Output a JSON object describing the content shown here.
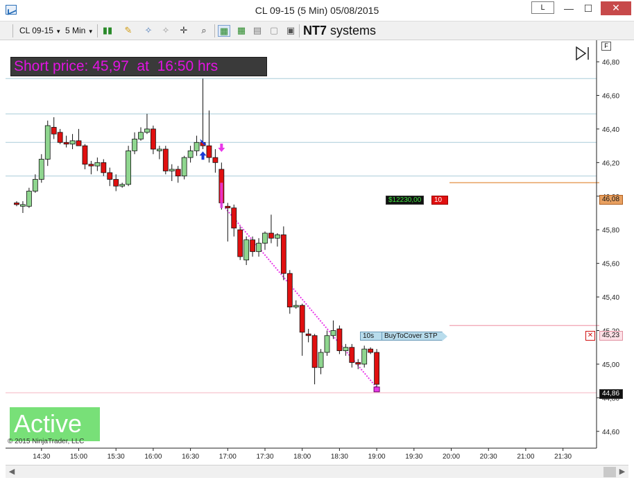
{
  "window": {
    "title": "CL 09-15 (5 Min)  05/08/2015",
    "layout_button": "L",
    "minimize": "—",
    "maximize": "☐",
    "close": "✕"
  },
  "toolbar": {
    "instrument": "CL 09-15",
    "interval": "5 Min",
    "brand_bold": "NT7",
    "brand_rest": " systems"
  },
  "chart": {
    "banner": "Short price: 45,97  at  16:50 hrs",
    "status": "Active",
    "copyright": "© 2015 NinjaTrader, LLC",
    "f_button": "F",
    "order_ticket": {
      "pnl": "$12230,00",
      "qty": "10",
      "price_tag": "46,08"
    },
    "stop_order": {
      "time_left": "10s",
      "label": "BuyToCover STP",
      "cancel": "✕",
      "price_tag": "45,23"
    },
    "last_price_tag": "44,86",
    "colors": {
      "up": "#8fd68f",
      "down": "#e01010",
      "signal": "#e838e8",
      "entry": "#1a3ad8",
      "grid": "#a8ccd8",
      "order_line": "#e8a060",
      "stop_line": "#f0a0b0",
      "last_line": "#f5b5c0"
    }
  },
  "chart_data": {
    "type": "candlestick",
    "title": "",
    "xlabel": "",
    "ylabel": "",
    "ylim": [
      44.5,
      46.92
    ],
    "y_ticks": [
      "46,80",
      "46,60",
      "46,40",
      "46,20",
      "46,00",
      "45,80",
      "45,60",
      "45,40",
      "45,20",
      "45,00",
      "44,80",
      "44,60"
    ],
    "y_tick_values": [
      46.8,
      46.6,
      46.4,
      46.2,
      46.0,
      45.8,
      45.6,
      45.4,
      45.2,
      45.0,
      44.8,
      44.6
    ],
    "x_ticks": [
      "14:30",
      "15:00",
      "15:30",
      "16:00",
      "16:30",
      "17:00",
      "17:30",
      "18:00",
      "18:30",
      "19:00",
      "19:30",
      "20:00",
      "20:30",
      "21:00",
      "21:30"
    ],
    "x_tick_minutes": [
      870,
      900,
      930,
      960,
      990,
      1020,
      1050,
      1080,
      1110,
      1140,
      1170,
      1200,
      1230,
      1260,
      1290
    ],
    "x_range_minutes": [
      840,
      1315
    ],
    "h_lines": [
      46.7,
      46.49,
      46.32,
      46.12,
      44.83
    ],
    "order_level": 46.08,
    "stop_level": 45.23,
    "last_price": 44.86,
    "bar_minutes": 5,
    "bars": [
      {
        "t": 850,
        "o": 45.96,
        "h": 45.97,
        "l": 45.94,
        "c": 45.95
      },
      {
        "t": 855,
        "o": 45.94,
        "h": 45.97,
        "l": 45.9,
        "c": 45.95
      },
      {
        "t": 860,
        "o": 45.94,
        "h": 46.05,
        "l": 45.93,
        "c": 46.03
      },
      {
        "t": 865,
        "o": 46.03,
        "h": 46.13,
        "l": 46.02,
        "c": 46.1
      },
      {
        "t": 870,
        "o": 46.1,
        "h": 46.25,
        "l": 46.08,
        "c": 46.22
      },
      {
        "t": 875,
        "o": 46.22,
        "h": 46.45,
        "l": 46.18,
        "c": 46.42
      },
      {
        "t": 880,
        "o": 46.41,
        "h": 46.47,
        "l": 46.34,
        "c": 46.37
      },
      {
        "t": 885,
        "o": 46.38,
        "h": 46.4,
        "l": 46.31,
        "c": 46.32
      },
      {
        "t": 890,
        "o": 46.32,
        "h": 46.36,
        "l": 46.29,
        "c": 46.31
      },
      {
        "t": 895,
        "o": 46.31,
        "h": 46.37,
        "l": 46.28,
        "c": 46.33
      },
      {
        "t": 900,
        "o": 46.33,
        "h": 46.4,
        "l": 46.3,
        "c": 46.3
      },
      {
        "t": 905,
        "o": 46.3,
        "h": 46.31,
        "l": 46.16,
        "c": 46.19
      },
      {
        "t": 910,
        "o": 46.19,
        "h": 46.21,
        "l": 46.13,
        "c": 46.18
      },
      {
        "t": 915,
        "o": 46.18,
        "h": 46.23,
        "l": 46.15,
        "c": 46.2
      },
      {
        "t": 920,
        "o": 46.2,
        "h": 46.22,
        "l": 46.12,
        "c": 46.14
      },
      {
        "t": 925,
        "o": 46.14,
        "h": 46.17,
        "l": 46.06,
        "c": 46.1
      },
      {
        "t": 930,
        "o": 46.1,
        "h": 46.13,
        "l": 46.03,
        "c": 46.06
      },
      {
        "t": 935,
        "o": 46.06,
        "h": 46.08,
        "l": 46.05,
        "c": 46.07
      },
      {
        "t": 940,
        "o": 46.07,
        "h": 46.3,
        "l": 46.06,
        "c": 46.27
      },
      {
        "t": 945,
        "o": 46.27,
        "h": 46.38,
        "l": 46.25,
        "c": 46.34
      },
      {
        "t": 950,
        "o": 46.34,
        "h": 46.41,
        "l": 46.33,
        "c": 46.38
      },
      {
        "t": 955,
        "o": 46.38,
        "h": 46.49,
        "l": 46.37,
        "c": 46.4
      },
      {
        "t": 960,
        "o": 46.4,
        "h": 46.42,
        "l": 46.25,
        "c": 46.28
      },
      {
        "t": 965,
        "o": 46.27,
        "h": 46.3,
        "l": 46.22,
        "c": 46.28
      },
      {
        "t": 970,
        "o": 46.28,
        "h": 46.3,
        "l": 46.13,
        "c": 46.15
      },
      {
        "t": 975,
        "o": 46.15,
        "h": 46.19,
        "l": 46.09,
        "c": 46.16
      },
      {
        "t": 980,
        "o": 46.16,
        "h": 46.18,
        "l": 46.08,
        "c": 46.12
      },
      {
        "t": 985,
        "o": 46.12,
        "h": 46.24,
        "l": 46.1,
        "c": 46.23
      },
      {
        "t": 990,
        "o": 46.23,
        "h": 46.3,
        "l": 46.2,
        "c": 46.27
      },
      {
        "t": 995,
        "o": 46.27,
        "h": 46.36,
        "l": 46.24,
        "c": 46.32
      },
      {
        "t": 1000,
        "o": 46.32,
        "h": 46.7,
        "l": 46.28,
        "c": 46.3
      },
      {
        "t": 1005,
        "o": 46.3,
        "h": 46.51,
        "l": 46.2,
        "c": 46.23
      },
      {
        "t": 1010,
        "o": 46.23,
        "h": 46.28,
        "l": 46.14,
        "c": 46.2
      },
      {
        "t": 1015,
        "o": 46.16,
        "h": 46.2,
        "l": 45.92,
        "c": 45.96
      },
      {
        "t": 1020,
        "o": 45.94,
        "h": 45.96,
        "l": 45.73,
        "c": 45.93
      },
      {
        "t": 1025,
        "o": 45.93,
        "h": 45.95,
        "l": 45.76,
        "c": 45.81
      },
      {
        "t": 1030,
        "o": 45.8,
        "h": 45.82,
        "l": 45.62,
        "c": 45.64
      },
      {
        "t": 1035,
        "o": 45.62,
        "h": 45.76,
        "l": 45.59,
        "c": 45.74
      },
      {
        "t": 1040,
        "o": 45.74,
        "h": 45.76,
        "l": 45.64,
        "c": 45.67
      },
      {
        "t": 1045,
        "o": 45.67,
        "h": 45.75,
        "l": 45.64,
        "c": 45.72
      },
      {
        "t": 1050,
        "o": 45.72,
        "h": 45.79,
        "l": 45.68,
        "c": 45.78
      },
      {
        "t": 1055,
        "o": 45.78,
        "h": 45.89,
        "l": 45.72,
        "c": 45.75
      },
      {
        "t": 1060,
        "o": 45.75,
        "h": 45.78,
        "l": 45.7,
        "c": 45.77
      },
      {
        "t": 1065,
        "o": 45.77,
        "h": 45.82,
        "l": 45.5,
        "c": 45.54
      },
      {
        "t": 1070,
        "o": 45.54,
        "h": 45.56,
        "l": 45.3,
        "c": 45.34
      },
      {
        "t": 1075,
        "o": 45.34,
        "h": 45.38,
        "l": 45.33,
        "c": 45.35
      },
      {
        "t": 1080,
        "o": 45.35,
        "h": 45.36,
        "l": 45.05,
        "c": 45.19
      },
      {
        "t": 1085,
        "o": 45.18,
        "h": 45.21,
        "l": 45.13,
        "c": 45.17
      },
      {
        "t": 1090,
        "o": 45.17,
        "h": 45.18,
        "l": 44.88,
        "c": 44.98
      },
      {
        "t": 1095,
        "o": 44.98,
        "h": 45.09,
        "l": 44.94,
        "c": 45.07
      },
      {
        "t": 1100,
        "o": 45.07,
        "h": 45.2,
        "l": 45.05,
        "c": 45.17
      },
      {
        "t": 1105,
        "o": 45.17,
        "h": 45.26,
        "l": 45.15,
        "c": 45.2
      },
      {
        "t": 1110,
        "o": 45.21,
        "h": 45.23,
        "l": 45.06,
        "c": 45.08
      },
      {
        "t": 1115,
        "o": 45.08,
        "h": 45.12,
        "l": 45.05,
        "c": 45.1
      },
      {
        "t": 1120,
        "o": 45.1,
        "h": 45.12,
        "l": 44.98,
        "c": 45.01
      },
      {
        "t": 1125,
        "o": 45.01,
        "h": 45.03,
        "l": 44.97,
        "c": 45.0
      },
      {
        "t": 1130,
        "o": 45.0,
        "h": 45.11,
        "l": 44.98,
        "c": 45.09
      },
      {
        "t": 1135,
        "o": 45.09,
        "h": 45.1,
        "l": 45.06,
        "c": 45.07
      },
      {
        "t": 1140,
        "o": 45.07,
        "h": 45.09,
        "l": 44.86,
        "c": 44.88
      }
    ],
    "signal_arrows_down": [
      {
        "t": 1000,
        "y": 46.79
      },
      {
        "t": 1015,
        "y": 46.28
      }
    ],
    "entry_marks": [
      {
        "t": 1000,
        "y": 46.25
      }
    ],
    "short_entry": {
      "t": 1015,
      "price": 45.97,
      "time": "16:50"
    },
    "trend_line": [
      {
        "t": 1018,
        "y": 45.93
      },
      {
        "t": 1140,
        "y": 44.86
      }
    ]
  }
}
